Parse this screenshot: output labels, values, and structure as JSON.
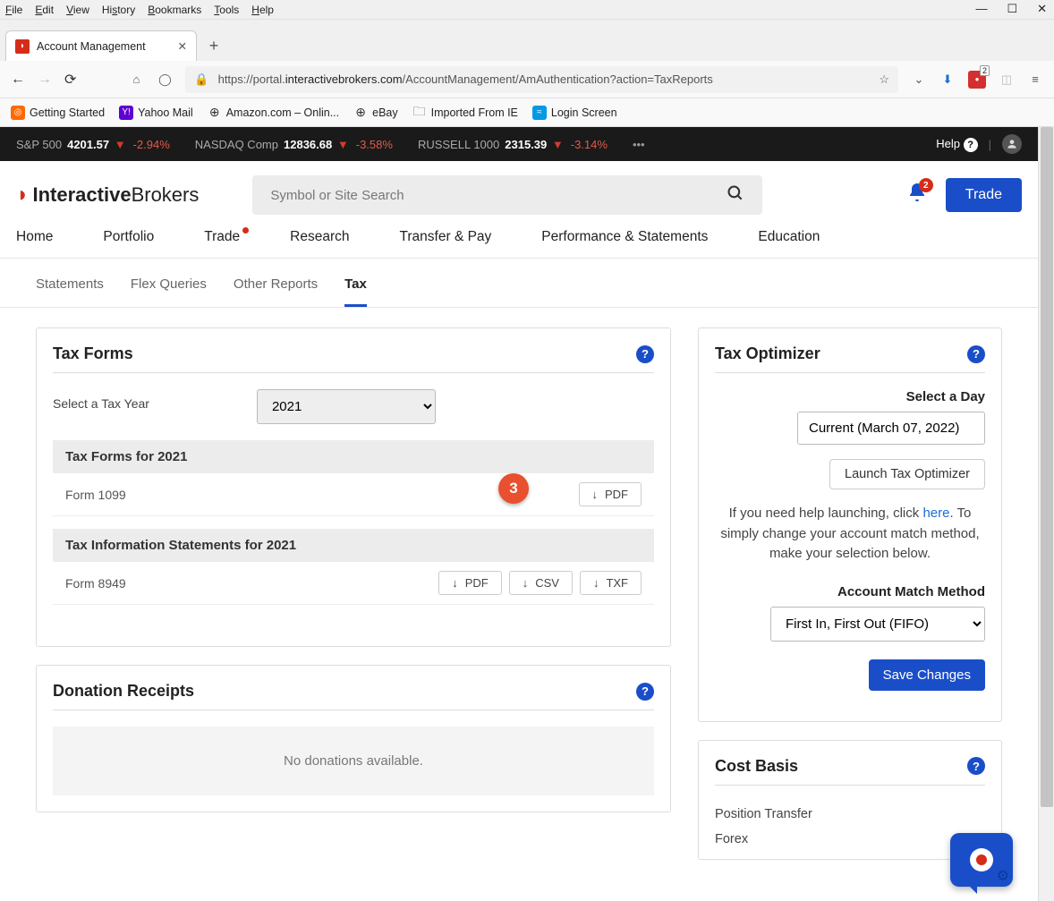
{
  "browser": {
    "menus": [
      "File",
      "Edit",
      "View",
      "History",
      "Bookmarks",
      "Tools",
      "Help"
    ],
    "tab_title": "Account Management",
    "url_prefix": "https://portal.",
    "url_domain": "interactivebrokers.com",
    "url_path": "/AccountManagement/AmAuthentication?action=TaxReports",
    "ext_badge": "2",
    "bookmarks": {
      "b1": "Getting Started",
      "b2": "Yahoo Mail",
      "b3": "Amazon.com – Onlin...",
      "b4": "eBay",
      "b5": "Imported From IE",
      "b6": "Login Screen"
    }
  },
  "ticker": {
    "items": [
      {
        "name": "S&P 500",
        "value": "4201.57",
        "change": "-2.94%"
      },
      {
        "name": "NASDAQ Comp",
        "value": "12836.68",
        "change": "-3.58%"
      },
      {
        "name": "RUSSELL 1000",
        "value": "2315.39",
        "change": "-3.14%"
      }
    ],
    "help": "Help"
  },
  "header": {
    "logo_strong": "Interactive",
    "logo_light": "Brokers",
    "search_placeholder": "Symbol or Site Search",
    "bell_count": "2",
    "trade_label": "Trade"
  },
  "mainnav": [
    "Home",
    "Portfolio",
    "Trade",
    "Research",
    "Transfer & Pay",
    "Performance & Statements",
    "Education"
  ],
  "subtabs": [
    "Statements",
    "Flex Queries",
    "Other Reports",
    "Tax"
  ],
  "active_subtab": "Tax",
  "tax_forms": {
    "title": "Tax Forms",
    "year_label": "Select a Tax Year",
    "year_value": "2021",
    "section1": "Tax Forms for 2021",
    "form1": "Form 1099",
    "pdf": "PDF",
    "section2": "Tax Information Statements for 2021",
    "form2": "Form 8949",
    "csv": "CSV",
    "txf": "TXF",
    "step_badge": "3"
  },
  "donations": {
    "title": "Donation Receipts",
    "empty": "No donations available."
  },
  "optimizer": {
    "title": "Tax Optimizer",
    "day_label": "Select a Day",
    "day_value": "Current (March 07, 2022)",
    "launch": "Launch Tax Optimizer",
    "help_text_1": "If you need help launching, click ",
    "help_link": "here",
    "help_text_2": ". To simply change your account match method, make your selection below.",
    "match_label": "Account Match Method",
    "match_value": "First In, First Out (FIFO)",
    "save": "Save Changes"
  },
  "cost_basis": {
    "title": "Cost Basis",
    "items": [
      "Position Transfer",
      "Forex"
    ]
  }
}
